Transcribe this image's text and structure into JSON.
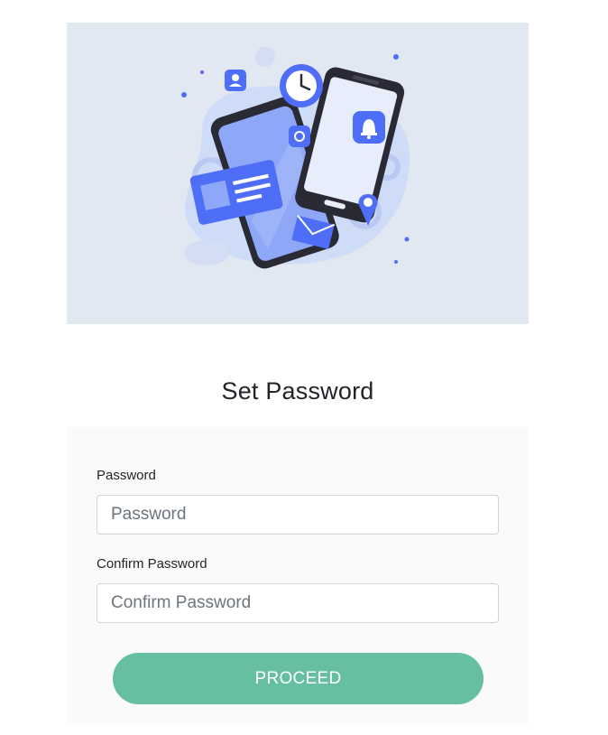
{
  "hero": {
    "illustration": "phones-notifications-illustration"
  },
  "page": {
    "title": "Set Password"
  },
  "form": {
    "password_label": "Password",
    "password_placeholder": "Password",
    "confirm_label": "Confirm Password",
    "confirm_placeholder": "Confirm Password",
    "proceed_label": "PROCEED"
  },
  "colors": {
    "hero_bg": "#e2e8f2",
    "accent_blue": "#4f6ef7",
    "button_green": "#66bfa2",
    "card_bg": "#fafafa"
  }
}
